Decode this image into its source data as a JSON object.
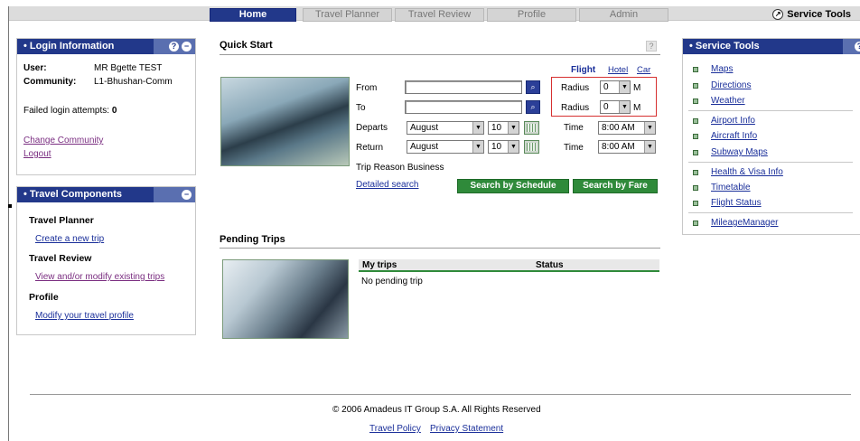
{
  "nav": {
    "tabs": [
      "Home",
      "Travel Planner",
      "Travel Review",
      "Profile",
      "Admin"
    ],
    "service_tools": "Service Tools"
  },
  "login": {
    "title": "Login Information",
    "user_label": "User:",
    "user_value": "MR Bgette TEST",
    "community_label": "Community:",
    "community_value": "L1-Bhushan-Comm",
    "failed_label": "Failed login attempts:",
    "failed_value": "0",
    "change_community": "Change Community",
    "logout": "Logout"
  },
  "components": {
    "title": "Travel Components",
    "planner_heading": "Travel Planner",
    "planner_link": "Create a new trip",
    "review_heading": "Travel Review",
    "review_link": "View and/or modify existing trips",
    "profile_heading": "Profile",
    "profile_link": "Modify your travel profile"
  },
  "quickstart": {
    "title": "Quick Start",
    "help": "?",
    "modes": {
      "flight": "Flight",
      "hotel": "Hotel",
      "car": "Car"
    },
    "from_label": "From",
    "to_label": "To",
    "from_value": "",
    "to_value": "",
    "departs_label": "Departs",
    "return_label": "Return",
    "departs_month": "August",
    "departs_day": "10",
    "return_month": "August",
    "return_day": "10",
    "radius_label": "Radius",
    "radius_from": "0",
    "radius_to": "0",
    "radius_unit": "M",
    "time_label": "Time",
    "departs_time": "8:00 AM",
    "return_time": "8:00 AM",
    "trip_reason_label": "Trip Reason",
    "trip_reason_value": "Business",
    "detailed_search": "Detailed search",
    "search_schedule": "Search by Schedule",
    "search_fare": "Search by Fare"
  },
  "pending": {
    "title": "Pending Trips",
    "col_trips": "My trips",
    "col_status": "Status",
    "empty": "No pending trip"
  },
  "service_tools": {
    "title": "Service Tools",
    "groups": [
      [
        "Maps",
        "Directions",
        "Weather"
      ],
      [
        "Airport Info",
        "Aircraft Info",
        "Subway Maps"
      ],
      [
        "Health & Visa Info",
        "Timetable",
        "Flight Status"
      ],
      [
        "MileageManager"
      ]
    ]
  },
  "footer": {
    "copyright": "© 2006 Amadeus IT Group S.A. All Rights Reserved",
    "travel_policy": "Travel Policy",
    "privacy": "Privacy Statement"
  },
  "colors": {
    "header_blue": "#22388a",
    "button_green": "#2f8a3a",
    "link_blue": "#1a2f9a",
    "link_purple": "#7a2d80",
    "highlight_red": "#d63030"
  }
}
